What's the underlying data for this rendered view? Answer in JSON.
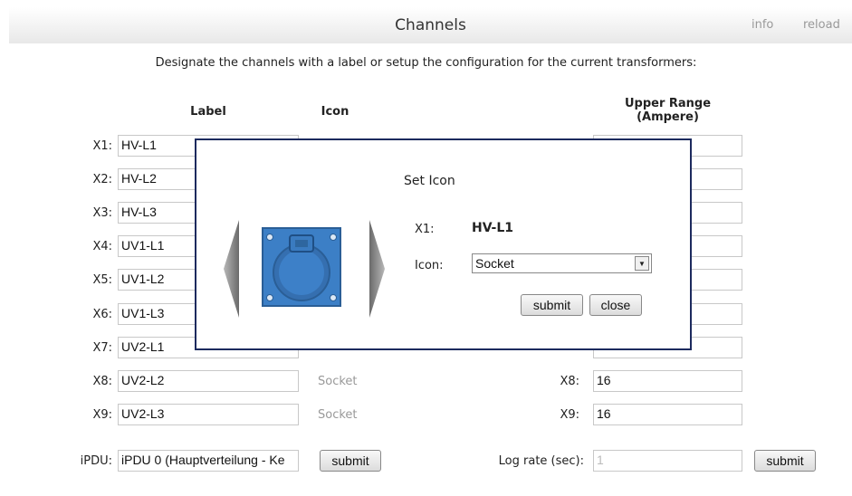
{
  "header": {
    "title": "Channels",
    "info_label": "info",
    "reload_label": "reload"
  },
  "intro_text": "Designate the channels with a label or setup the configuration for the current transformers:",
  "columns": {
    "label": "Label",
    "icon": "Icon",
    "upper_range_1": "Upper Range",
    "upper_range_2": "(Ampere)"
  },
  "channels": [
    {
      "id": "X1:",
      "label": "HV-L1"
    },
    {
      "id": "X2:",
      "label": "HV-L2"
    },
    {
      "id": "X3:",
      "label": "HV-L3"
    },
    {
      "id": "X4:",
      "label": "UV1-L1"
    },
    {
      "id": "X5:",
      "label": "UV1-L2"
    },
    {
      "id": "X6:",
      "label": "UV1-L3"
    },
    {
      "id": "X7:",
      "label": "UV2-L1"
    },
    {
      "id": "X8:",
      "label": "UV2-L2",
      "icon": "Socket",
      "range_id": "X8:",
      "range": "16"
    },
    {
      "id": "X9:",
      "label": "UV2-L3",
      "icon": "Socket",
      "range_id": "X9:",
      "range": "16"
    }
  ],
  "footer": {
    "ipdu_label": "iPDU:",
    "ipdu_value": "iPDU 0 (Hauptverteilung - Ke",
    "submit_label": "submit",
    "lograte_label": "Log rate (sec):",
    "lograte_value": "1",
    "submit2_label": "submit"
  },
  "modal": {
    "title": "Set Icon",
    "channel_label": "X1:",
    "channel_value": "HV-L1",
    "icon_label": "Icon:",
    "icon_selected": "Socket",
    "submit_label": "submit",
    "close_label": "close",
    "image_icon": "socket-icon"
  }
}
